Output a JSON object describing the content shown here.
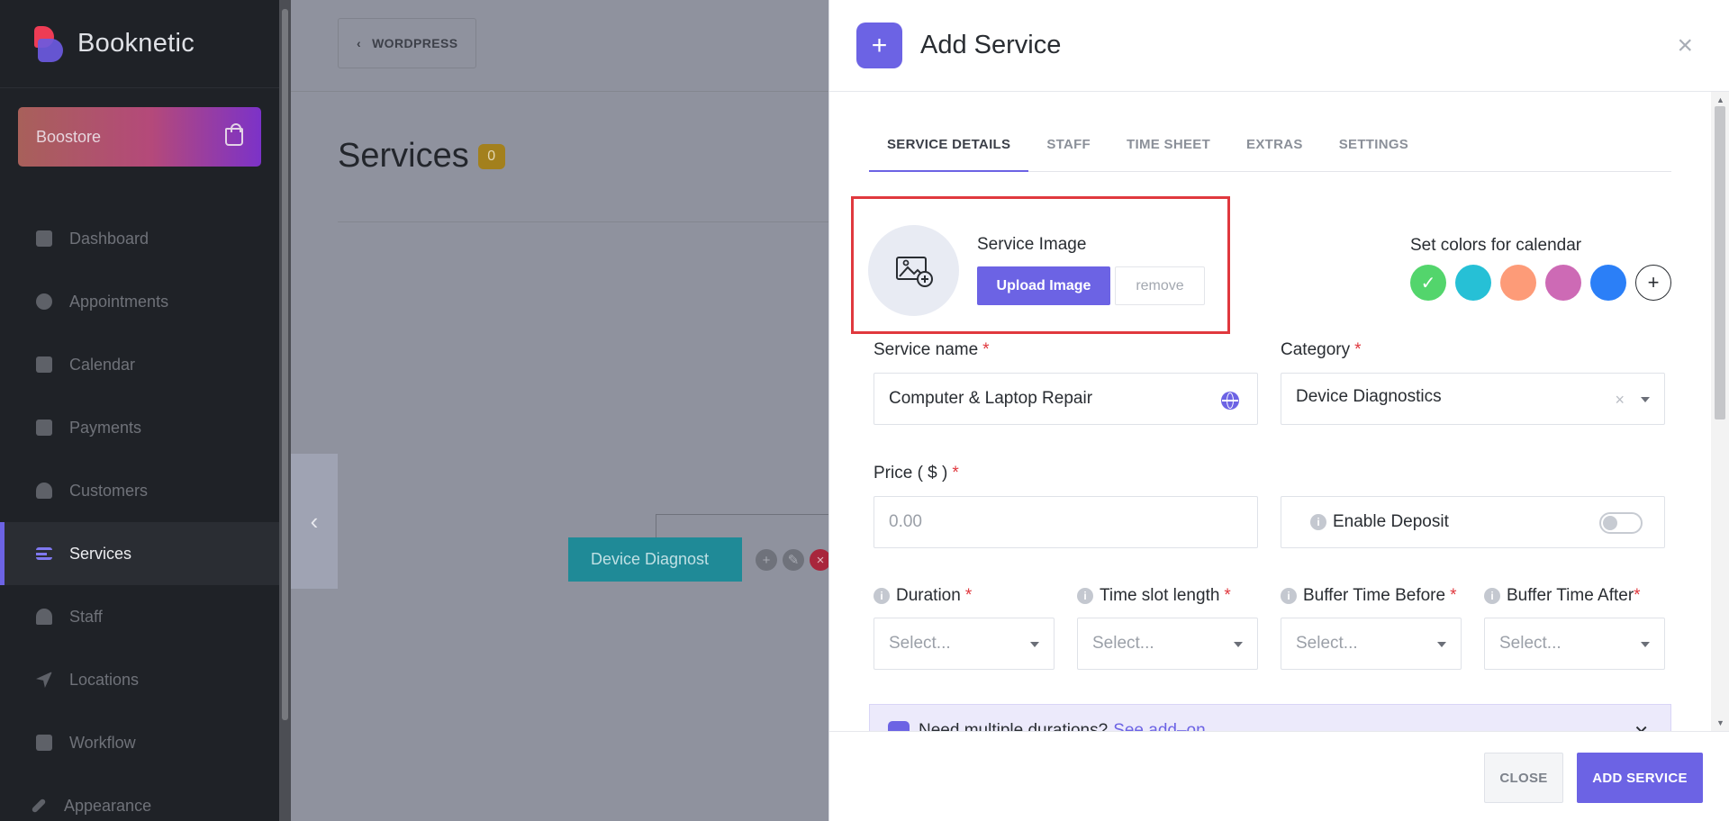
{
  "brand": {
    "name": "Booknetic"
  },
  "boostore": {
    "label": "Boostore"
  },
  "sidebar": {
    "items": [
      {
        "label": "Dashboard",
        "icon": "cube-icon"
      },
      {
        "label": "Appointments",
        "icon": "clock-icon"
      },
      {
        "label": "Calendar",
        "icon": "calendar-icon"
      },
      {
        "label": "Payments",
        "icon": "wallet-icon"
      },
      {
        "label": "Customers",
        "icon": "users-icon"
      },
      {
        "label": "Services",
        "icon": "list-icon",
        "active": true
      },
      {
        "label": "Staff",
        "icon": "user-icon"
      },
      {
        "label": "Locations",
        "icon": "location-arrow-icon"
      },
      {
        "label": "Workflow",
        "icon": "workflow-icon"
      },
      {
        "label": "Appearance",
        "icon": "brush-icon"
      }
    ]
  },
  "topbar": {
    "back_label": "WORDPRESS"
  },
  "page": {
    "title": "Services",
    "count": "0"
  },
  "tree": {
    "category_node": "Device Diagnost"
  },
  "modal": {
    "title": "Add Service",
    "tabs": [
      "SERVICE DETAILS",
      "STAFF",
      "TIME SHEET",
      "EXTRAS",
      "SETTINGS"
    ],
    "service_image": {
      "label": "Service Image",
      "upload": "Upload Image",
      "remove": "remove"
    },
    "colors": {
      "label": "Set colors for calendar",
      "swatches": [
        "#53d56c",
        "#26c0d6",
        "#fd9b78",
        "#cd6ab5",
        "#2b7ff7"
      ],
      "selected_index": 0
    },
    "fields": {
      "service_name": {
        "label": "Service name",
        "value": "Computer & Laptop Repair"
      },
      "category": {
        "label": "Category",
        "value": "Device Diagnostics"
      },
      "price": {
        "label": "Price ( $ )",
        "placeholder": "0.00"
      },
      "deposit": {
        "label": "Enable Deposit",
        "enabled": false
      },
      "duration": {
        "label": "Duration",
        "placeholder": "Select..."
      },
      "time_slot": {
        "label": "Time slot length",
        "placeholder": "Select..."
      },
      "buffer_before": {
        "label": "Buffer Time Before",
        "placeholder": "Select..."
      },
      "buffer_after": {
        "label": "Buffer Time After",
        "placeholder": "Select..."
      },
      "required_mark": "*"
    },
    "addon_notice": {
      "text": "Need multiple durations?",
      "link": "See add–on"
    },
    "footer": {
      "close": "CLOSE",
      "submit": "ADD SERVICE"
    }
  }
}
